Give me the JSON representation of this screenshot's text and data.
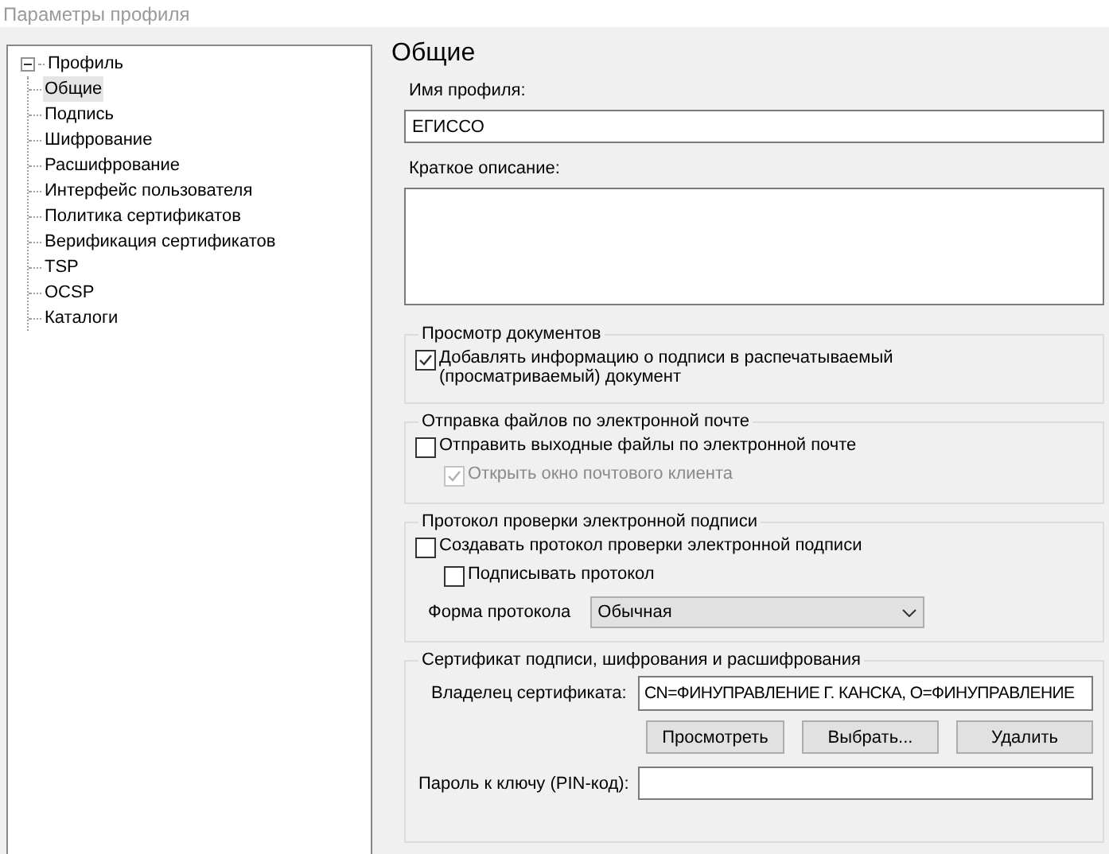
{
  "window": {
    "title": "Параметры профиля"
  },
  "tree": {
    "label": "Профиль",
    "expanded": true,
    "children": [
      {
        "label": "Общие",
        "selected": true
      },
      {
        "label": "Подпись",
        "selected": false
      },
      {
        "label": "Шифрование",
        "selected": false
      },
      {
        "label": "Расшифрование",
        "selected": false
      },
      {
        "label": "Интерфейс пользователя",
        "selected": false
      },
      {
        "label": "Политика сертификатов",
        "selected": false
      },
      {
        "label": "Верификация сертификатов",
        "selected": false
      },
      {
        "label": "TSP",
        "selected": false
      },
      {
        "label": "OCSP",
        "selected": false
      },
      {
        "label": "Каталоги",
        "selected": false
      }
    ]
  },
  "page_title": "Общие",
  "profile_name": {
    "label": "Имя профиля:",
    "value": "ЕГИССО"
  },
  "description": {
    "label": "Краткое описание:"
  },
  "groups": [
    {
      "title": "Просмотр документов",
      "items": [
        {
          "kind": "checkbox",
          "label": "Добавлять информацию о подписи в распечатываемый (просматриваемый) документ",
          "checked": true,
          "disabled": false,
          "indented": false
        }
      ]
    },
    {
      "title": "Отправка файлов по электронной почте",
      "items": [
        {
          "kind": "checkbox",
          "label": "Отправить выходные файлы по электронной почте",
          "checked": false,
          "disabled": false,
          "indented": false
        },
        {
          "kind": "checkbox",
          "label": "Открыть окно почтового клиента",
          "checked": true,
          "disabled": true,
          "indented": true
        }
      ]
    },
    {
      "title": "Протокол проверки электронной подписи",
      "items": [
        {
          "kind": "checkbox",
          "label": "Создавать протокол проверки электронной подписи",
          "checked": false,
          "disabled": false,
          "indented": false
        },
        {
          "kind": "checkbox",
          "label": "Подписывать протокол",
          "checked": false,
          "disabled": false,
          "indented": true
        },
        {
          "kind": "select",
          "label": "Форма протокола",
          "value": "Обычная"
        }
      ]
    }
  ],
  "certificate": {
    "title": "Сертификат подписи, шифрования и расшифрования",
    "owner_label": "Владелец сертификата:",
    "owner_value": "CN=ФИНУПРАВЛЕНИЕ Г. КАНСКА, O=ФИНУПРАВЛЕНИЕ",
    "buttons": [
      "Просмотреть",
      "Выбрать...",
      "Удалить"
    ],
    "pin_label": "Пароль к ключу (PIN-код):"
  }
}
